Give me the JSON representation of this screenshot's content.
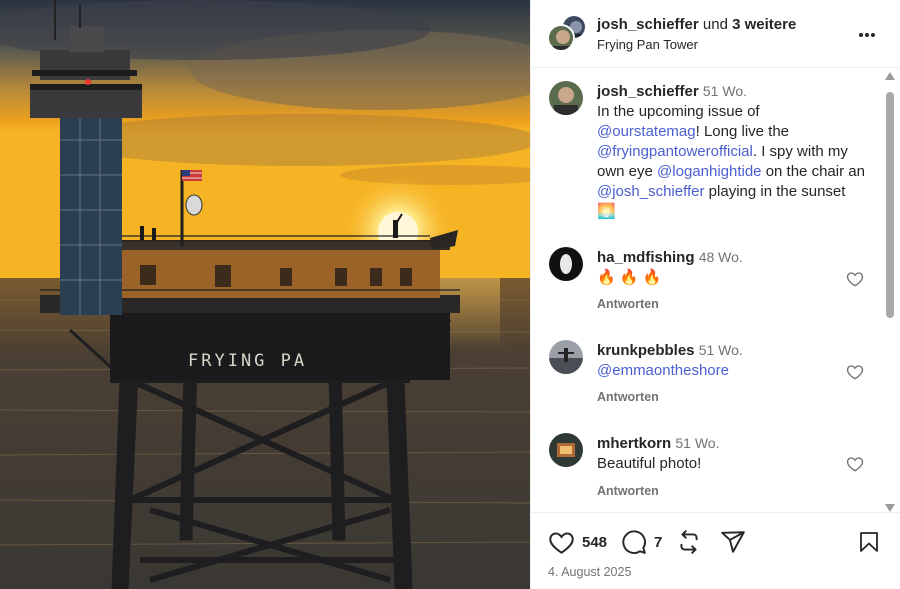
{
  "post": {
    "author": "josh_schieffer",
    "coauthors_joiner": "und",
    "coauthors_count": "3 weitere",
    "location": "Frying Pan Tower",
    "caption": {
      "user": "josh_schieffer",
      "time": "51 Wo.",
      "parts": [
        {
          "text": "In the upcoming issue of ",
          "link": false
        },
        {
          "text": "@ourstatemag",
          "link": true
        },
        {
          "text": "!  Long live the ",
          "link": false
        },
        {
          "text": "@fryingpantowerofficial",
          "link": true
        },
        {
          "text": ".  I spy with my own eye ",
          "link": false
        },
        {
          "text": "@loganhightide",
          "link": true
        },
        {
          "text": " on the chair an ",
          "link": false
        },
        {
          "text": "@josh_schieffer",
          "link": true
        },
        {
          "text": " playing in the sunset ",
          "link": false
        },
        {
          "text": "🌅",
          "link": false
        }
      ]
    },
    "comments": [
      {
        "user": "ha_mdfishing",
        "time": "48 Wo.",
        "text": "🔥 🔥 🔥",
        "is_link": false,
        "reply": "Antworten"
      },
      {
        "user": "krunkpebbles",
        "time": "51 Wo.",
        "text": "@emmaontheshore",
        "is_link": true,
        "reply": "Antworten"
      },
      {
        "user": "mhertkorn",
        "time": "51 Wo.",
        "text": "Beautiful photo!",
        "is_link": false,
        "reply": "Antworten"
      }
    ],
    "likes": "548",
    "comment_count": "7",
    "date": "4. August 2025"
  },
  "photo": {
    "sign_text": "FRYING PA"
  },
  "colors": {
    "link": "#4a5fd1",
    "muted": "#737373",
    "text": "#262626"
  },
  "icons": [
    "more-options-icon",
    "heart-icon",
    "comment-icon",
    "repost-icon",
    "share-icon",
    "bookmark-icon",
    "scroll-up-icon",
    "scroll-down-icon"
  ]
}
